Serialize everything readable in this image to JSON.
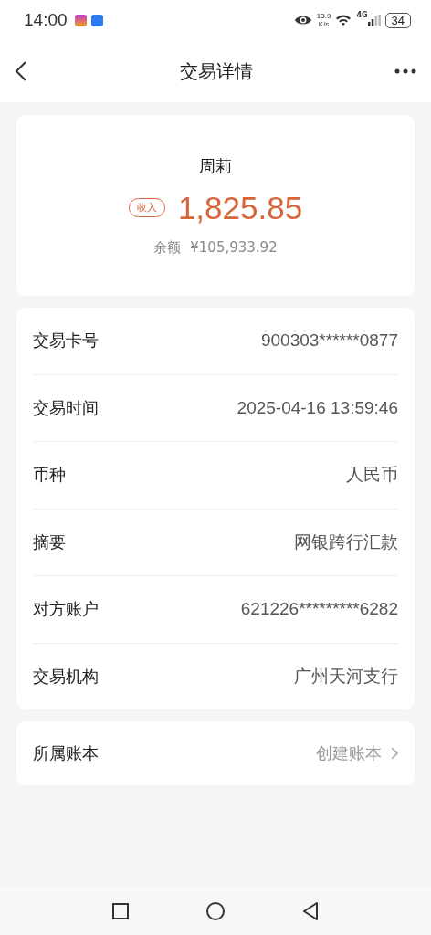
{
  "status_bar": {
    "time": "14:00",
    "speed": "13.9",
    "speed_unit": "K/s",
    "network": "4G",
    "battery": "34"
  },
  "header": {
    "title": "交易详情"
  },
  "summary": {
    "name": "周莉",
    "tag": "收入",
    "amount": "1,825.85",
    "balance_label": "余额",
    "balance": "¥105,933.92"
  },
  "details": [
    {
      "label": "交易卡号",
      "value": "900303******0877"
    },
    {
      "label": "交易时间",
      "value": "2025-04-16 13:59:46"
    },
    {
      "label": "币种",
      "value": "人民币"
    },
    {
      "label": "摘要",
      "value": "网银跨行汇款"
    },
    {
      "label": "对方账户",
      "value": "621226*********6282"
    },
    {
      "label": "交易机构",
      "value": "广州天河支行"
    }
  ],
  "ledger": {
    "label": "所属账本",
    "value": "创建账本"
  }
}
